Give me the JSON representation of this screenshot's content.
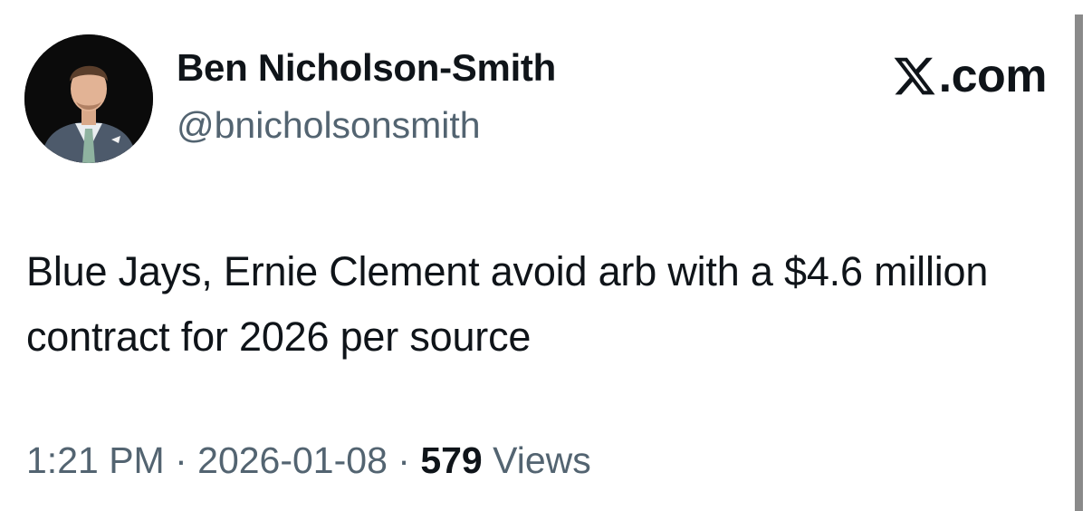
{
  "author": {
    "name": "Ben Nicholson-Smith",
    "handle": "@bnicholsonsmith"
  },
  "brand": {
    "label": ".com",
    "logo_icon": "x-logo-icon"
  },
  "tweet": {
    "text": "Blue Jays, Ernie Clement avoid arb with a $4.6 million contract for 2026 per source"
  },
  "meta": {
    "time": "1:21 PM",
    "separator": " · ",
    "date": "2026-01-08",
    "views_count": "579",
    "views_label": "Views"
  },
  "colors": {
    "text": "#0f1419",
    "secondary": "#536471",
    "background": "#ffffff"
  }
}
